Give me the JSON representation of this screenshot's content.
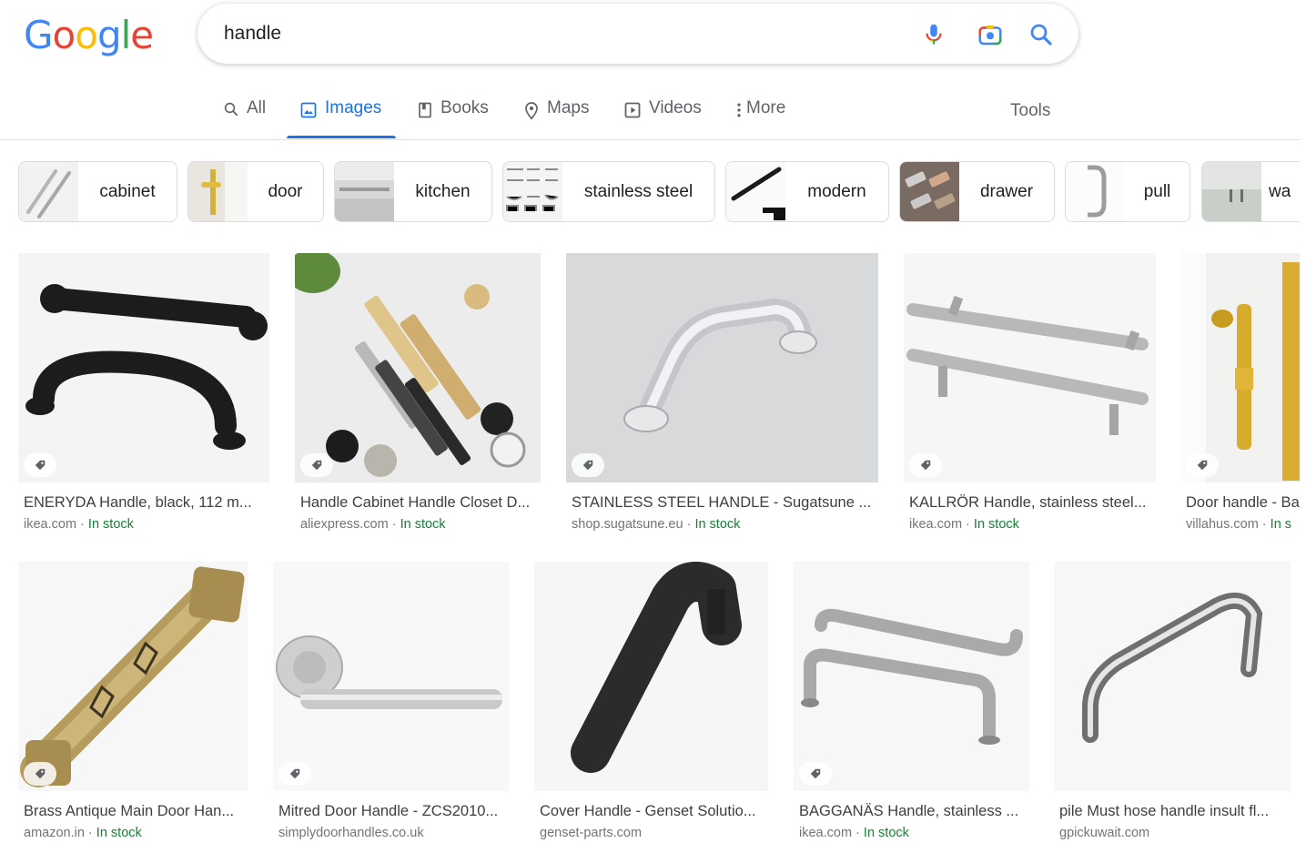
{
  "logo": {
    "text": "Google",
    "letters": [
      "G",
      "o",
      "o",
      "g",
      "l",
      "e"
    ],
    "colors": [
      "#4285F4",
      "#EA4335",
      "#FBBC05",
      "#4285F4",
      "#34A853",
      "#EA4335"
    ]
  },
  "search": {
    "query": "handle",
    "icons": [
      "mic-icon",
      "camera-icon",
      "search-icon"
    ]
  },
  "tabs": [
    {
      "label": "All",
      "icon": "search-icon"
    },
    {
      "label": "Images",
      "icon": "image-icon",
      "active": true
    },
    {
      "label": "Books",
      "icon": "book-icon"
    },
    {
      "label": "Maps",
      "icon": "map-pin-icon"
    },
    {
      "label": "Videos",
      "icon": "video-icon"
    },
    {
      "label": "More",
      "icon": "dots-vertical-icon"
    }
  ],
  "tools_label": "Tools",
  "chips": [
    {
      "label": "cabinet"
    },
    {
      "label": "door"
    },
    {
      "label": "kitchen"
    },
    {
      "label": "stainless steel"
    },
    {
      "label": "modern"
    },
    {
      "label": "drawer"
    },
    {
      "label": "pull"
    },
    {
      "label": "wa"
    }
  ],
  "results_row1": [
    {
      "title": "ENERYDA Handle, black, 112 m...",
      "site": "ikea.com",
      "stock": "In stock"
    },
    {
      "title": "Handle Cabinet Handle Closet D...",
      "site": "aliexpress.com",
      "stock": "In stock"
    },
    {
      "title": "STAINLESS STEEL HANDLE - Sugatsune ...",
      "site": "shop.sugatsune.eu",
      "stock": "In stock"
    },
    {
      "title": "KALLRÖR Handle, stainless steel...",
      "site": "ikea.com",
      "stock": "In stock"
    },
    {
      "title": "Door handle - Ba",
      "site": "villahus.com",
      "stock": "In s"
    }
  ],
  "results_row2": [
    {
      "title": "Brass Antique Main Door Han...",
      "site": "amazon.in",
      "stock": "In stock"
    },
    {
      "title": "Mitred Door Handle - ZCS2010...",
      "site": "simplydoorhandles.co.uk",
      "stock": ""
    },
    {
      "title": "Cover Handle - Genset Solutio...",
      "site": "genset-parts.com",
      "stock": ""
    },
    {
      "title": "BAGGANÄS Handle, stainless ...",
      "site": "ikea.com",
      "stock": "In stock"
    },
    {
      "title": "pile Must hose handle insult fl...",
      "site": "gpickuwait.com",
      "stock": ""
    }
  ]
}
